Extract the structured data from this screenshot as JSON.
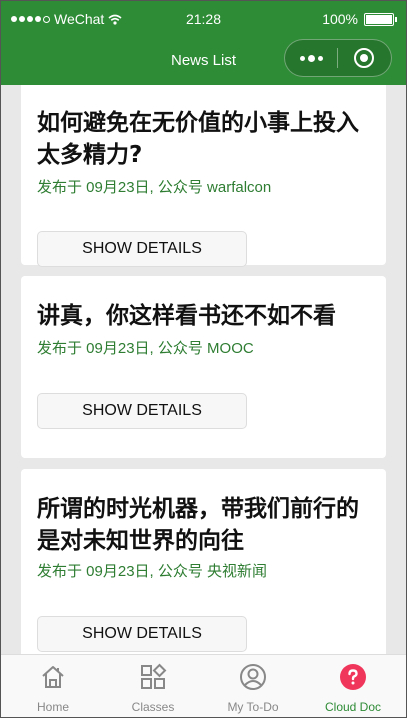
{
  "status_bar": {
    "carrier": "WeChat",
    "time": "21:28",
    "battery": "100%"
  },
  "nav": {
    "title": "News List"
  },
  "articles": [
    {
      "title": "如何避免在无价值的小事上投入太多精力?",
      "meta": "发布于 09月23日, 公众号 warfalcon",
      "button": "SHOW DETAILS"
    },
    {
      "title": "讲真，你这样看书还不如不看",
      "meta": "发布于 09月23日, 公众号 MOOC",
      "button": "SHOW DETAILS"
    },
    {
      "title": "所谓的时光机器，带我们前行的是对未知世界的向往",
      "meta": "发布于 09月23日, 公众号 央视新闻",
      "button": "SHOW DETAILS"
    }
  ],
  "tabs": [
    {
      "label": "Home",
      "icon": "home-icon"
    },
    {
      "label": "Classes",
      "icon": "grid-icon"
    },
    {
      "label": "My To-Do",
      "icon": "user-icon"
    },
    {
      "label": "Cloud Doc",
      "icon": "help-icon",
      "active": true
    }
  ],
  "colors": {
    "brand": "#2e8b36",
    "meta_text": "#2e7d32",
    "active_tab_icon": "#f0365b"
  }
}
